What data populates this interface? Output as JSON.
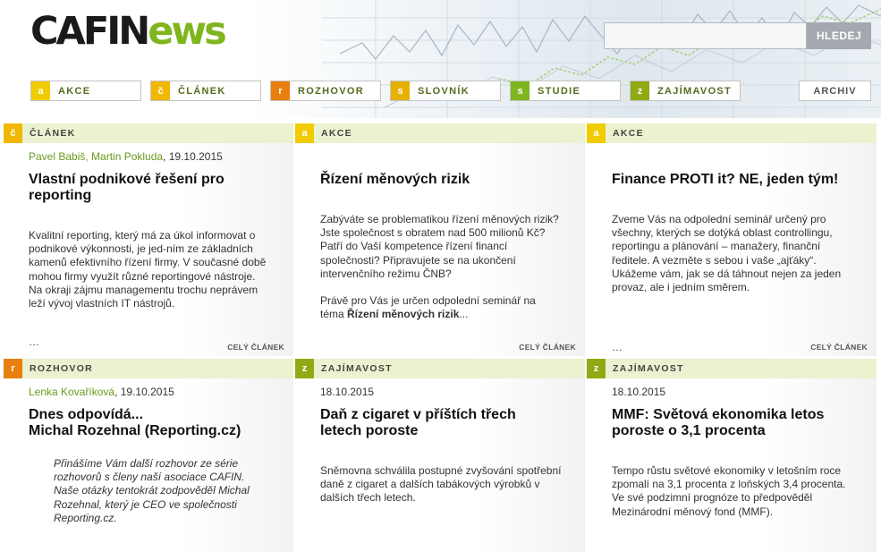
{
  "brand": {
    "logo_part1": "CAFIN",
    "logo_part2": "ews",
    "accent": "#7fb51f"
  },
  "search": {
    "value": "",
    "placeholder": "",
    "button_label": "HLEDEJ"
  },
  "nav": {
    "items": [
      {
        "letter": "a",
        "label": "AKCE",
        "color": "#f1cc00"
      },
      {
        "letter": "č",
        "label": "ČLÁNEK",
        "color": "#f0b800"
      },
      {
        "letter": "r",
        "label": "ROZHOVOR",
        "color": "#e87f0e"
      },
      {
        "letter": "s",
        "label": "SLOVNÍK",
        "color": "#e6b200"
      },
      {
        "letter": "s",
        "label": "STUDIE",
        "color": "#7fb51f"
      },
      {
        "letter": "z",
        "label": "ZAJÍMAVOST",
        "color": "#8faa13"
      }
    ],
    "archive_label": "ARCHIV"
  },
  "cards": [
    {
      "letter": "č",
      "category": "ČLÁNEK",
      "color": "#f0b800",
      "author": "Pavel Babiš, Martin Pokluda",
      "date": ", 19.10.2015",
      "title_lines": [
        "Vlastní podnikové řešení pro",
        "reporting"
      ],
      "paragraphs": [
        "Kvalitní reporting, který má za úkol informovat o podnikové výkonnosti, je jed-ním ze základních kamenů efektivního řízení firmy. V současné době mohou firmy využít různé reportingové nástroje. Na okraji zájmu managementu trochu neprávem leží vývoj vlastních IT nástrojů."
      ],
      "ellipsis": "…",
      "more": "CELÝ ČLÁNEK"
    },
    {
      "letter": "a",
      "category": "AKCE",
      "color": "#f1cc00",
      "title_lines": [
        "Řízení měnových rizik"
      ],
      "paragraphs": [
        "Zabýváte se problematikou řízení měnových rizik? Jste společnost s obratem nad 500 milionů Kč? Patří do Vaší kompetence řízení financí společnosti? Připravujete se na ukončení intervenčního režimu ČNB?",
        "Právě pro Vás je určen odpolední seminář na téma "
      ],
      "bold_tail": "Řízení měnových rizik",
      "tail_suffix": "...",
      "more": "CELÝ ČLÁNEK"
    },
    {
      "letter": "a",
      "category": "AKCE",
      "color": "#f1cc00",
      "title_lines": [
        "Finance PROTI it? NE, jeden tým!"
      ],
      "paragraphs": [
        "Zveme Vás na odpolední seminář určený pro všechny, kterých se dotýká oblast controllingu, reportingu a plánování – manažery, finanční ředitele. A vezměte s sebou i vaše „ajťáky“. Ukážeme vám, jak se dá táhnout nejen za jeden provaz, ale i jedním směrem."
      ],
      "ellipsis": "…",
      "more": "CELÝ ČLÁNEK"
    },
    {
      "letter": "r",
      "category": "ROZHOVOR",
      "color": "#e87f0e",
      "author": "Lenka Kovaříková",
      "date": ", 19.10.2015",
      "title_lines": [
        "Dnes odpovídá...",
        "Michal Rozehnal (Reporting.cz)"
      ],
      "paragraphs": [
        "Přinášíme Vám další rozhovor ze série rozhovorů s členy naší asociace CAFIN. Naše otázky tentokrát zodpověděl Michal Rozehnal, který je CEO ve společnosti Reporting.cz."
      ]
    },
    {
      "letter": "z",
      "category": "ZAJÍMAVOST",
      "color": "#8faa13",
      "date": "18.10.2015",
      "title_lines": [
        "Daň z cigaret v příštích třech",
        "letech poroste"
      ],
      "paragraphs": [
        "Sněmovna schválila postupné zvyšování spotřební daně z cigaret a dalších tabákových výrobků v dalších třech letech."
      ]
    },
    {
      "letter": "z",
      "category": "ZAJÍMAVOST",
      "color": "#8faa13",
      "date": "18.10.2015",
      "title_lines": [
        "MMF: Světová ekonomika letos",
        "poroste o 3,1 procenta"
      ],
      "paragraphs": [
        "Tempo růstu světové ekonomiky v letošním roce zpomalí na 3,1 procenta z loňských 3,4 procenta. Ve své podzimní prognóze to předpověděl Mezinárodní měnový fond (MMF)."
      ]
    }
  ]
}
